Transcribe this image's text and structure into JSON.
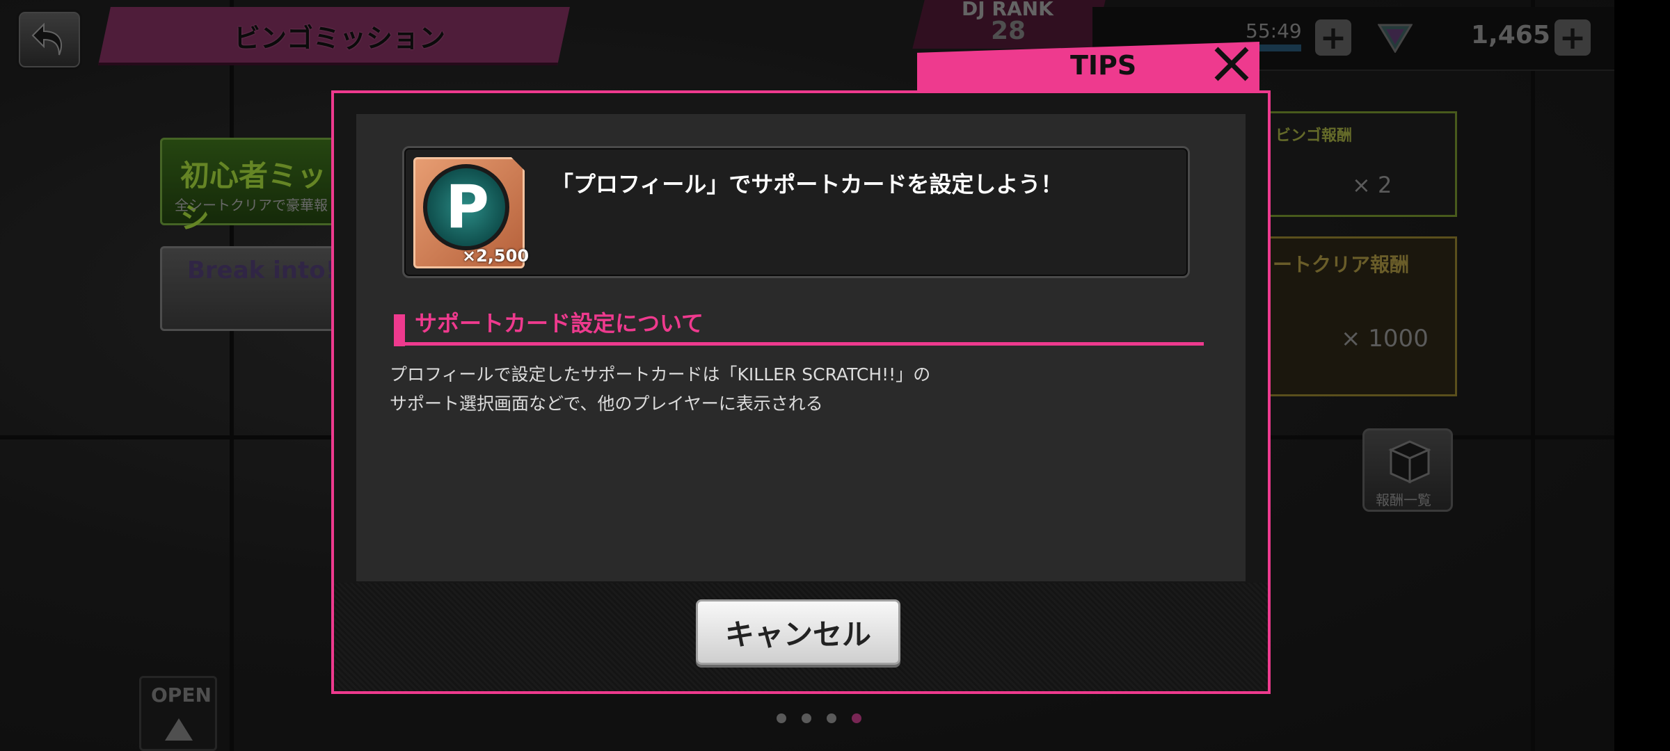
{
  "header": {
    "title": "ビンゴミッション",
    "dj_rank_label": "DJ RANK",
    "dj_rank_value": "28",
    "stamina_timer": "55:49",
    "gem_count": "1,465"
  },
  "sheets": {
    "beginner_title": "初心者ミッシ",
    "beginner_sub": "全シートクリアで豪華報",
    "event_title": "Break into!"
  },
  "rewards": {
    "bingo_label": "ビンゴ報酬",
    "bingo_count": "× 2",
    "sheet_clear_label": "ートクリア報酬",
    "sheet_clear_count": "× 1000",
    "list_button": "報酬一覧"
  },
  "open_button": "OPEN",
  "page_dots": {
    "count": 4,
    "active_index": 3
  },
  "tips": {
    "tab_label": "TIPS",
    "mission_title": "「プロフィール」でサポートカードを設定しよう！",
    "reward_quantity": "×2,500",
    "section_title": "サポートカード設定について",
    "description_line1": "プロフィールで設定したサポートカードは「KILLER SCRATCH!!」の",
    "description_line2": "サポート選択画面などで、他のプレイヤーに表示される",
    "cancel_label": "キャンセル"
  },
  "colors": {
    "accent_pink": "#ee3a8e",
    "active_dot": "#b83b82"
  }
}
